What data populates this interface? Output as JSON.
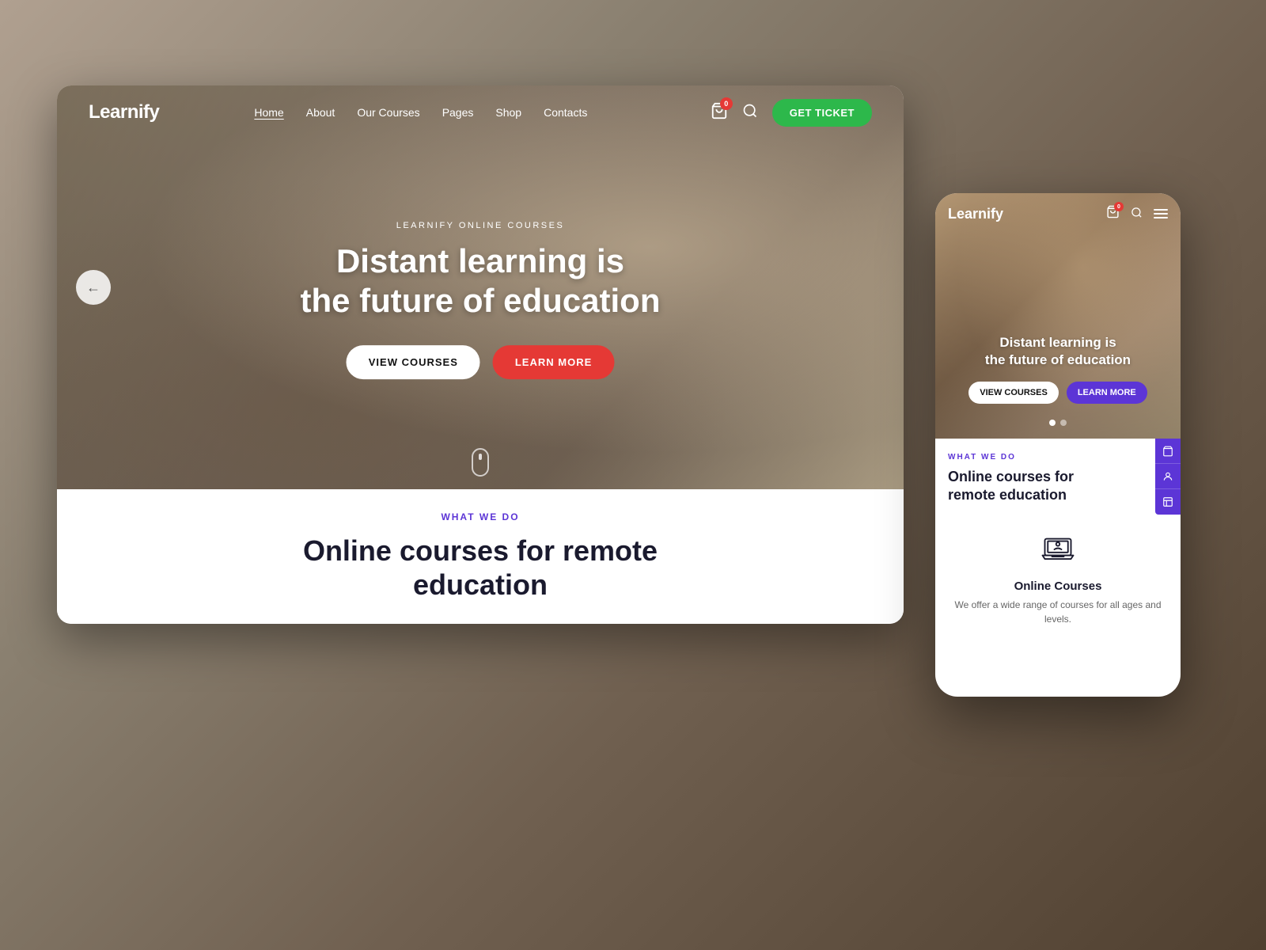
{
  "background": {
    "color": "#888"
  },
  "desktop": {
    "logo": "Learnify",
    "nav": {
      "links": [
        "Home",
        "About",
        "Our Courses",
        "Pages",
        "Shop",
        "Contacts"
      ],
      "active": "Home"
    },
    "cart_badge": "0",
    "get_ticket_label": "GET TICKET",
    "hero": {
      "subtitle": "LEARNIFY ONLINE COURSES",
      "title_line1": "Distant learning is",
      "title_line2": "the future of education",
      "btn_view": "VIEW COURSES",
      "btn_learn": "LEARN MORE",
      "scroll_label": "scroll"
    },
    "bottom": {
      "what_we_do": "WHAT WE DO",
      "title_line1": "Online courses for remote",
      "title_line2": "education"
    }
  },
  "mobile": {
    "logo": "Learnify",
    "cart_badge": "0",
    "hero": {
      "title_line1": "Distant learning is",
      "title_line2": "the future of education",
      "btn_view": "VIEW COURSES",
      "btn_learn": "LEARN MORE"
    },
    "bottom": {
      "what_we_do": "WHAT WE DO",
      "title_line1": "Online courses for",
      "title_line2": "remote education",
      "feature": {
        "title": "Online Courses",
        "desc": "We offer a wide range of courses for all ages and levels."
      }
    },
    "side_icons": [
      "cart",
      "person",
      "layout"
    ]
  }
}
